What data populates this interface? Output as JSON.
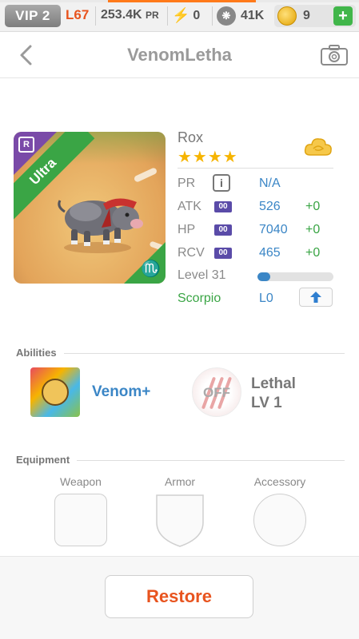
{
  "topbar": {
    "vip": "VIP 2",
    "level": "L67",
    "pr_value": "253.4K",
    "pr_unit": "PR",
    "energy": "0",
    "paws": "41K",
    "coins": "9",
    "plus_label": "+"
  },
  "header": {
    "title": "VenomLetha"
  },
  "pet": {
    "name": "Rox",
    "stars": "★★★★",
    "rarity_letter": "R",
    "tier": "Ultra",
    "sign_glyph": "♏",
    "stats": {
      "pr": {
        "label": "PR",
        "info": "i",
        "value": "N/A"
      },
      "atk": {
        "label": "ATK",
        "tag": "00",
        "value": "526",
        "bonus": "+0"
      },
      "hp": {
        "label": "HP",
        "tag": "00",
        "value": "7040",
        "bonus": "+0"
      },
      "rcv": {
        "label": "RCV",
        "tag": "00",
        "value": "465",
        "bonus": "+0"
      },
      "level": {
        "label": "Level 31",
        "progress": 0.17
      },
      "sign": {
        "label": "Scorpio",
        "value": "L0"
      }
    }
  },
  "abilities": {
    "title": "Abilities",
    "primary": "Venom+",
    "secondary": {
      "state": "OFF",
      "name": "Lethal",
      "level": "LV 1"
    }
  },
  "equipment": {
    "title": "Equipment",
    "slots": [
      "Weapon",
      "Armor",
      "Accessory"
    ]
  },
  "footer": {
    "restore_label": "Restore"
  },
  "colors": {
    "accent_blue": "#3b86c6",
    "accent_green": "#3aa545",
    "accent_orange": "#e8541f"
  }
}
